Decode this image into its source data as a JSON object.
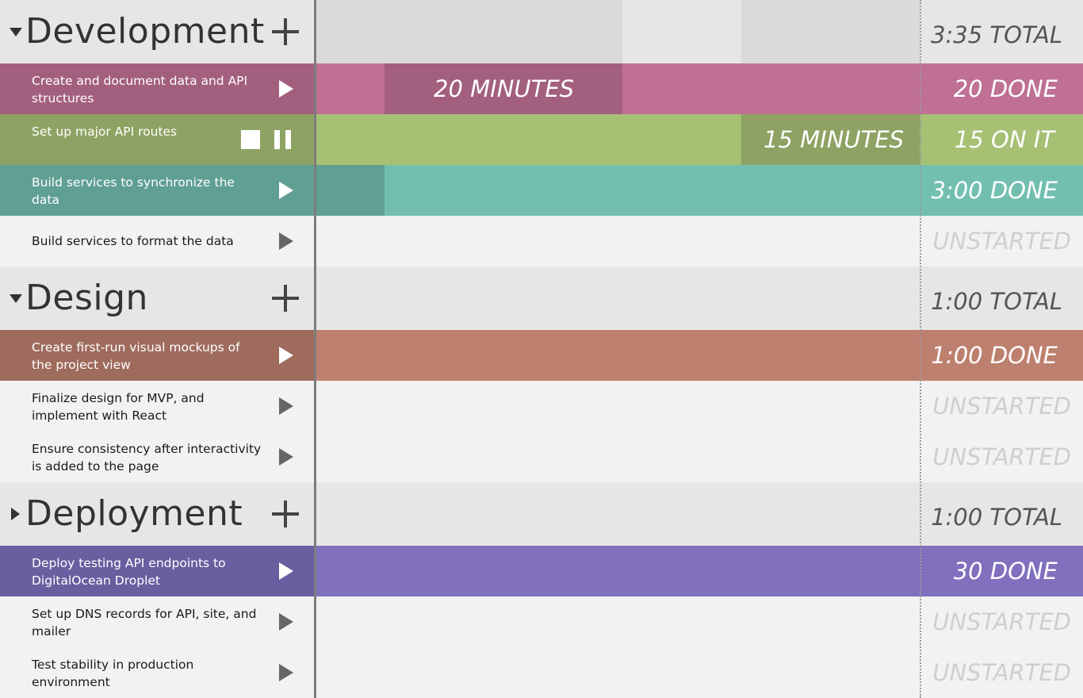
{
  "colors": {
    "pink": "#bf7094",
    "pink_dark": "#a35f7e",
    "green": "#a6c074",
    "green_dark": "#8ea363",
    "teal": "#72bfb0",
    "teal_dark": "#609f93",
    "salmon": "#be806e",
    "salmon_dark": "#9e6b5d",
    "purple": "#8070bd",
    "purple_dark": "#6a5ea0"
  },
  "groups": [
    {
      "title": "Development",
      "expanded": true,
      "total": "3:35 TOTAL",
      "tasks": [
        {
          "label": "Create and document data and API structures",
          "status": "20 DONE",
          "segment": "20 MINUTES",
          "icon": "play-icon"
        },
        {
          "label": "Set up major API routes",
          "status": "15 ON IT",
          "segment": "15 MINUTES",
          "icon": "stop-pause-icons"
        },
        {
          "label": "Build services to synchronize the data",
          "status": "3:00 DONE",
          "icon": "play-icon"
        },
        {
          "label": "Build services to format the data",
          "status": "UNSTARTED",
          "icon": "play-icon"
        }
      ]
    },
    {
      "title": "Design",
      "expanded": true,
      "total": "1:00 TOTAL",
      "tasks": [
        {
          "label": "Create first-run visual mockups of the project view",
          "status": "1:00 DONE",
          "icon": "play-icon"
        },
        {
          "label": "Finalize design for MVP, and implement with React",
          "status": "UNSTARTED",
          "icon": "play-icon"
        },
        {
          "label": "Ensure consistency after interactivity is added to the page",
          "status": "UNSTARTED",
          "icon": "play-icon"
        }
      ]
    },
    {
      "title": "Deployment",
      "expanded": false,
      "total": "1:00 TOTAL",
      "tasks": [
        {
          "label": "Deploy testing API endpoints to DigitalOcean Droplet",
          "status": "30 DONE",
          "icon": "play-icon"
        },
        {
          "label": "Set up DNS records for API, site, and mailer",
          "status": "UNSTARTED",
          "icon": "play-icon"
        },
        {
          "label": "Test stability in production environment",
          "status": "UNSTARTED",
          "icon": "play-icon"
        }
      ]
    }
  ]
}
